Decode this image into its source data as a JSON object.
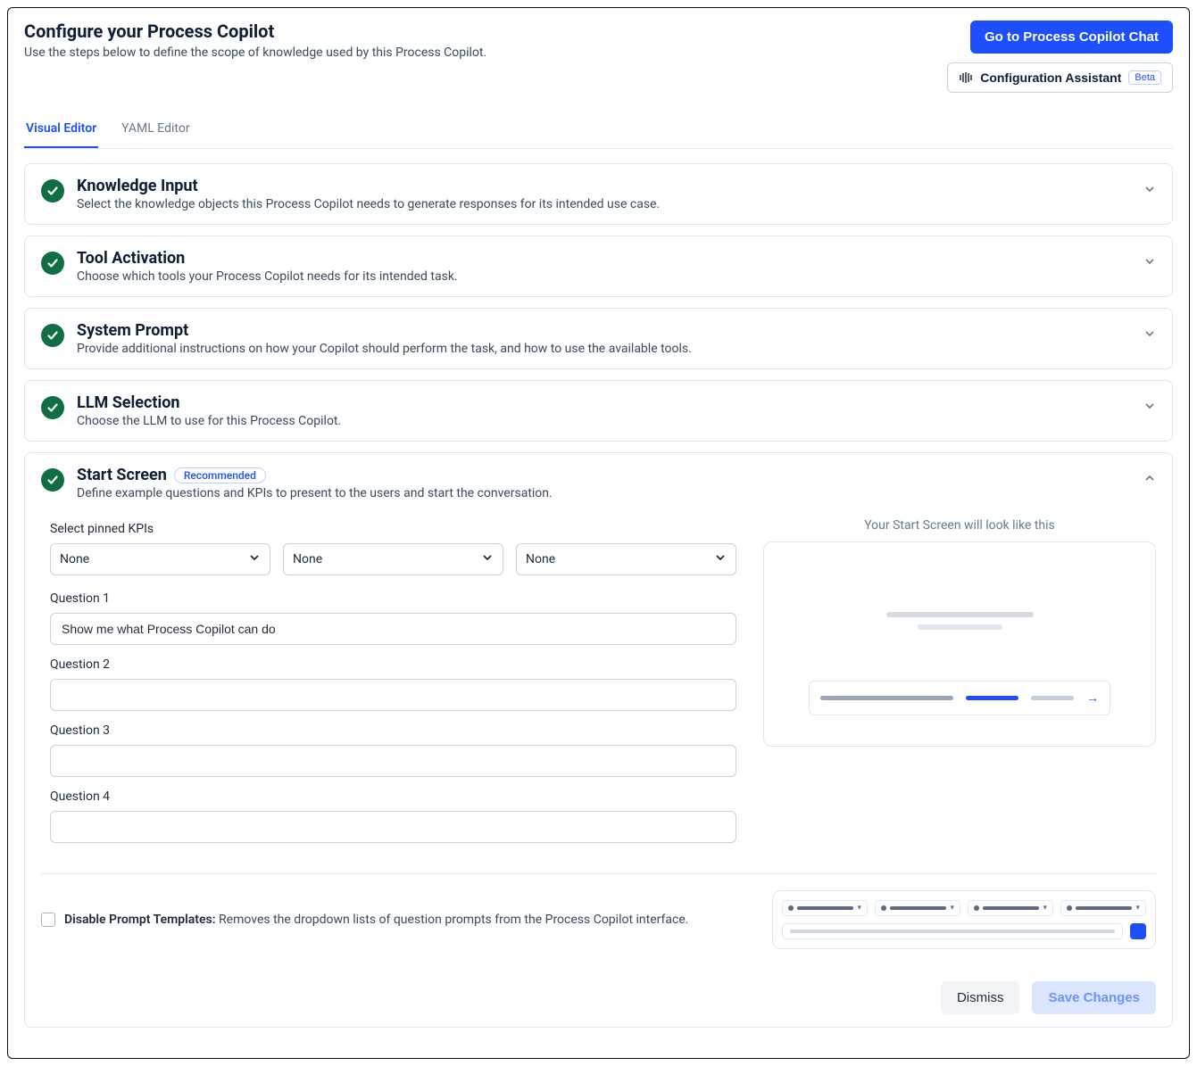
{
  "header": {
    "title": "Configure your Process Copilot",
    "subtitle": "Use the steps below to define the scope of knowledge used by this Process Copilot.",
    "primary_button": "Go to Process Copilot Chat",
    "assistant_button": "Configuration Assistant",
    "assistant_badge": "Beta"
  },
  "tabs": {
    "visual": "Visual Editor",
    "yaml": "YAML Editor"
  },
  "sections": {
    "knowledge": {
      "title": "Knowledge Input",
      "desc": "Select the knowledge objects this Process Copilot needs to generate responses for its intended use case."
    },
    "tool": {
      "title": "Tool Activation",
      "desc": "Choose which tools your Process Copilot needs for its intended task."
    },
    "system": {
      "title": "System Prompt",
      "desc": "Provide additional instructions on how your Copilot should perform the task, and how to use the available tools."
    },
    "llm": {
      "title": "LLM Selection",
      "desc": "Choose the LLM to use for this Process Copilot."
    },
    "start": {
      "title": "Start Screen",
      "badge": "Recommended",
      "desc": "Define example questions and KPIs to present to the users and start the conversation."
    }
  },
  "startScreen": {
    "kpi_label": "Select pinned KPIs",
    "kpi_options": [
      "None",
      "None",
      "None"
    ],
    "questions": [
      {
        "label": "Question 1",
        "value": "Show me what Process Copilot can do"
      },
      {
        "label": "Question 2",
        "value": ""
      },
      {
        "label": "Question 3",
        "value": ""
      },
      {
        "label": "Question 4",
        "value": ""
      }
    ],
    "preview_label": "Your Start Screen will look like this",
    "disable_label": "Disable Prompt Templates:",
    "disable_desc": "Removes the dropdown lists of question prompts from the Process Copilot interface."
  },
  "footer": {
    "dismiss": "Dismiss",
    "save": "Save Changes"
  }
}
